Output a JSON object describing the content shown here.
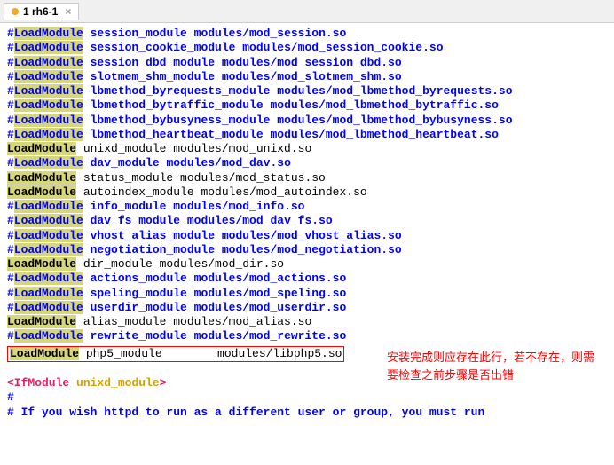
{
  "tab": {
    "label": "1 rh6-1",
    "modified": true
  },
  "lines": [
    {
      "type": "commented",
      "dir": "LoadModule",
      "rest": " session_module modules/mod_session.so"
    },
    {
      "type": "commented",
      "dir": "LoadModule",
      "rest": " session_cookie_module modules/mod_session_cookie.so"
    },
    {
      "type": "commented",
      "dir": "LoadModule",
      "rest": " session_dbd_module modules/mod_session_dbd.so"
    },
    {
      "type": "commented",
      "dir": "LoadModule",
      "rest": " slotmem_shm_module modules/mod_slotmem_shm.so"
    },
    {
      "type": "commented",
      "dir": "LoadModule",
      "rest": " lbmethod_byrequests_module modules/mod_lbmethod_byrequests.so"
    },
    {
      "type": "commented",
      "dir": "LoadModule",
      "rest": " lbmethod_bytraffic_module modules/mod_lbmethod_bytraffic.so"
    },
    {
      "type": "commented",
      "dir": "LoadModule",
      "rest": " lbmethod_bybusyness_module modules/mod_lbmethod_bybusyness.so"
    },
    {
      "type": "commented",
      "dir": "LoadModule",
      "rest": " lbmethod_heartbeat_module modules/mod_lbmethod_heartbeat.so"
    },
    {
      "type": "active",
      "dir": "LoadModule",
      "rest": " unixd_module modules/mod_unixd.so"
    },
    {
      "type": "commented",
      "dir": "LoadModule",
      "rest": " dav_module modules/mod_dav.so"
    },
    {
      "type": "active",
      "dir": "LoadModule",
      "rest": " status_module modules/mod_status.so"
    },
    {
      "type": "active",
      "dir": "LoadModule",
      "rest": " autoindex_module modules/mod_autoindex.so"
    },
    {
      "type": "commented",
      "dir": "LoadModule",
      "rest": " info_module modules/mod_info.so"
    },
    {
      "type": "commented",
      "dir": "LoadModule",
      "rest": " dav_fs_module modules/mod_dav_fs.so"
    },
    {
      "type": "commented",
      "dir": "LoadModule",
      "rest": " vhost_alias_module modules/mod_vhost_alias.so"
    },
    {
      "type": "commented",
      "dir": "LoadModule",
      "rest": " negotiation_module modules/mod_negotiation.so"
    },
    {
      "type": "active",
      "dir": "LoadModule",
      "rest": " dir_module modules/mod_dir.so"
    },
    {
      "type": "commented",
      "dir": "LoadModule",
      "rest": " actions_module modules/mod_actions.so"
    },
    {
      "type": "commented",
      "dir": "LoadModule",
      "rest": " speling_module modules/mod_speling.so"
    },
    {
      "type": "commented",
      "dir": "LoadModule",
      "rest": " userdir_module modules/mod_userdir.so"
    },
    {
      "type": "active",
      "dir": "LoadModule",
      "rest": " alias_module modules/mod_alias.so"
    },
    {
      "type": "commented",
      "dir": "LoadModule",
      "rest": " rewrite_module modules/mod_rewrite.so"
    }
  ],
  "boxed_line": {
    "dir": "LoadModule",
    "rest": " php5_module        modules/libphp5.so"
  },
  "annotation": "安装完成则应存在此行，若不存在，则需要检查之前步骤是否出错",
  "ifmodule": {
    "open": "<IfModule ",
    "arg": "unixd_module",
    "close": ">"
  },
  "hash_only": "#",
  "final_comment": "# If you wish httpd to run as a different user or group, you must run"
}
